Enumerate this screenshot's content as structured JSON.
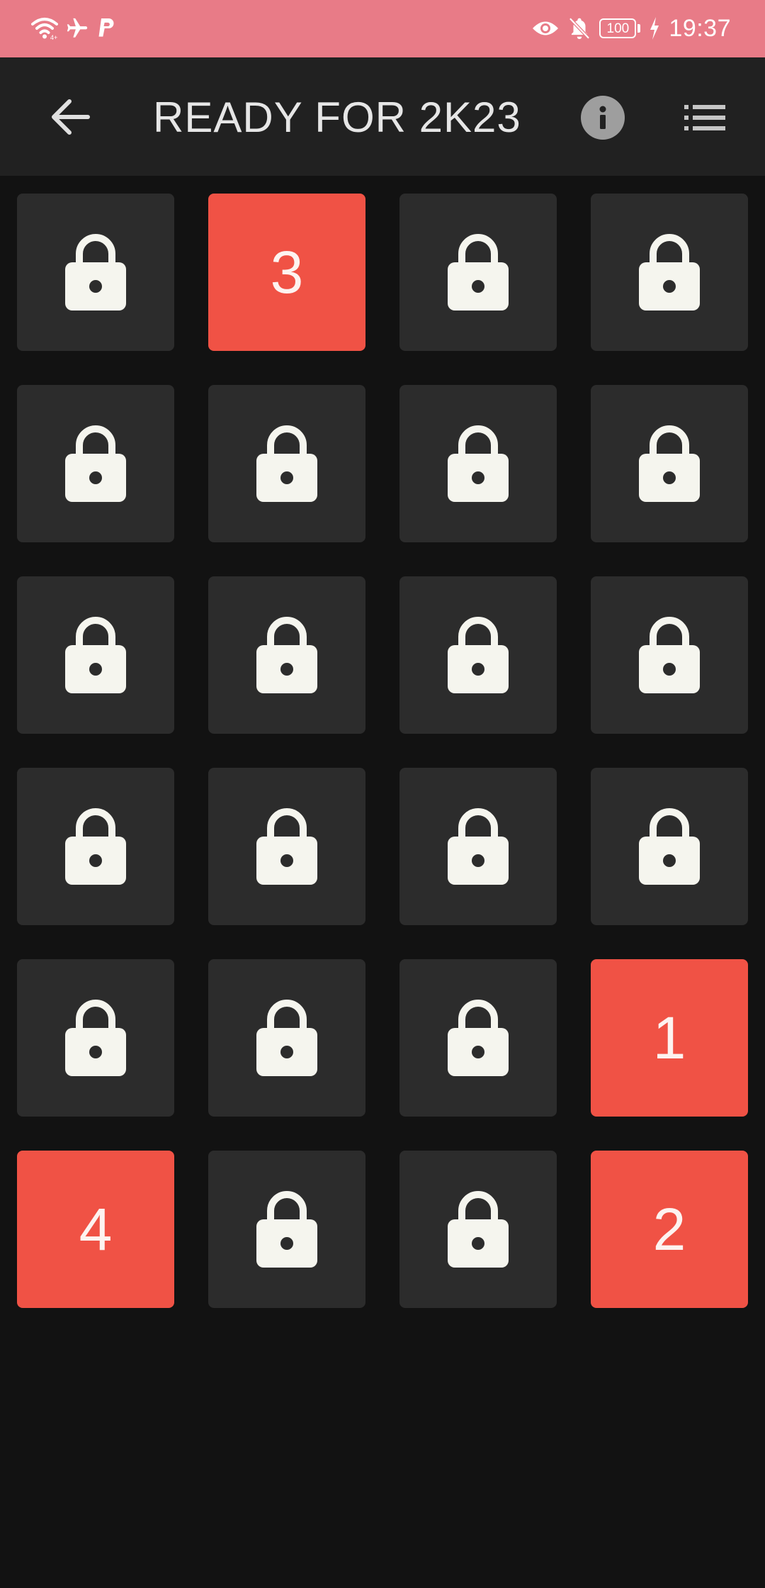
{
  "status_bar": {
    "time": "19:37",
    "battery": "100",
    "background_color": "#e87b87",
    "left_icons": [
      "wifi-icon",
      "airplane-icon",
      "paypal-icon"
    ],
    "right_icons": [
      "eye-icon",
      "bell-off-icon",
      "battery-icon",
      "charging-icon"
    ]
  },
  "toolbar": {
    "title": "READY FOR 2K23",
    "back_icon": "arrow-left-icon",
    "info_icon": "info-icon",
    "list_icon": "list-icon"
  },
  "colors": {
    "locked_tile": "#2c2c2c",
    "unlocked_tile": "#f05245",
    "lock_glyph": "#f5f5ee",
    "background": "#121212",
    "toolbar": "#212121"
  },
  "levels": [
    {
      "locked": true,
      "label": ""
    },
    {
      "locked": false,
      "label": "3"
    },
    {
      "locked": true,
      "label": ""
    },
    {
      "locked": true,
      "label": ""
    },
    {
      "locked": true,
      "label": ""
    },
    {
      "locked": true,
      "label": ""
    },
    {
      "locked": true,
      "label": ""
    },
    {
      "locked": true,
      "label": ""
    },
    {
      "locked": true,
      "label": ""
    },
    {
      "locked": true,
      "label": ""
    },
    {
      "locked": true,
      "label": ""
    },
    {
      "locked": true,
      "label": ""
    },
    {
      "locked": true,
      "label": ""
    },
    {
      "locked": true,
      "label": ""
    },
    {
      "locked": true,
      "label": ""
    },
    {
      "locked": true,
      "label": ""
    },
    {
      "locked": true,
      "label": ""
    },
    {
      "locked": true,
      "label": ""
    },
    {
      "locked": true,
      "label": ""
    },
    {
      "locked": false,
      "label": "1"
    },
    {
      "locked": false,
      "label": "4"
    },
    {
      "locked": true,
      "label": ""
    },
    {
      "locked": true,
      "label": ""
    },
    {
      "locked": false,
      "label": "2"
    }
  ]
}
